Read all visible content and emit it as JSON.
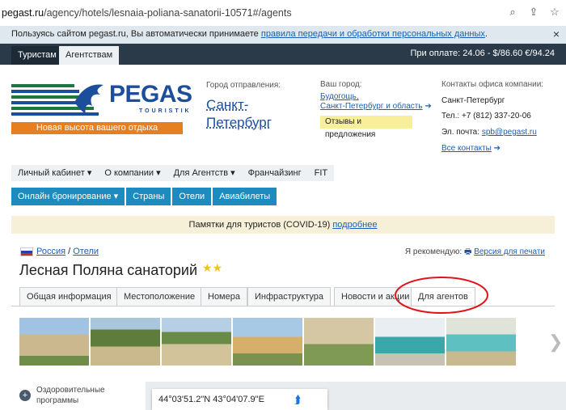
{
  "browser": {
    "url_prefix": "pegast.ru",
    "url_rest": "/agency/hotels/lesnaia-poliana-sanatorii-10571#/agents"
  },
  "cookie": {
    "text": "Пользуясь сайтом pegast.ru, Вы автоматически принимаете ",
    "link": "правила передачи и обработки персональных данных",
    "end": ".",
    "close": "×"
  },
  "topbar": {
    "tab_tourists": "Туристам",
    "tab_agents": "Агентствам",
    "rate": "При оплате: 24.06 - $/86.60 €/94.24"
  },
  "logo": {
    "brand": "PEGAS",
    "sub": "TOURISTIK",
    "slogan": "Новая высота вашего отдыха"
  },
  "departure": {
    "label": "Город отправления:",
    "city1": "Санкт-",
    "city2": "Петербург"
  },
  "your_city": {
    "label": "Ваш город:",
    "line1": "Будогощь,",
    "line2": "Санкт-Петербург и область",
    "feedback": "Отзывы и предложения"
  },
  "contacts": {
    "label": "Контакты офиса компании:",
    "city": "Санкт-Петербург",
    "phone": "Тел.: +7 (812) 337-20-06",
    "email_label": "Эл. почта: ",
    "email": "spb@pegast.ru",
    "all": "Все контакты"
  },
  "menu1": [
    "Личный кабинет ▾",
    "О компании ▾",
    "Для Агентств ▾",
    "Франчайзинг",
    "FIT"
  ],
  "menu2": [
    "Онлайн бронирование ▾",
    "Страны",
    "Отели",
    "Авиабилеты"
  ],
  "notice": {
    "text": "Памятки для туристов (COVID-19) ",
    "link": "подробнее"
  },
  "breadcrumb": {
    "country": "Россия",
    "sep": " / ",
    "hotels": "Отели"
  },
  "recommend": {
    "label": "Я рекомендую: ",
    "print": "Версия для печати"
  },
  "hotel": {
    "name": "Лесная Поляна санаторий",
    "stars": "★★"
  },
  "tabs": [
    "Общая информация",
    "Местоположение",
    "Номера",
    "Инфраструктура",
    "Новости и акции",
    "Для агентов"
  ],
  "side": {
    "line1": "Оздоровительные",
    "line2": "программы"
  },
  "map": {
    "coords": "44°03'51.2\"N 43°04'07.9\"E"
  },
  "colors": {
    "accent": "#1c8bbf",
    "brand": "#1b4e9b",
    "highlight": "#e0141b"
  }
}
